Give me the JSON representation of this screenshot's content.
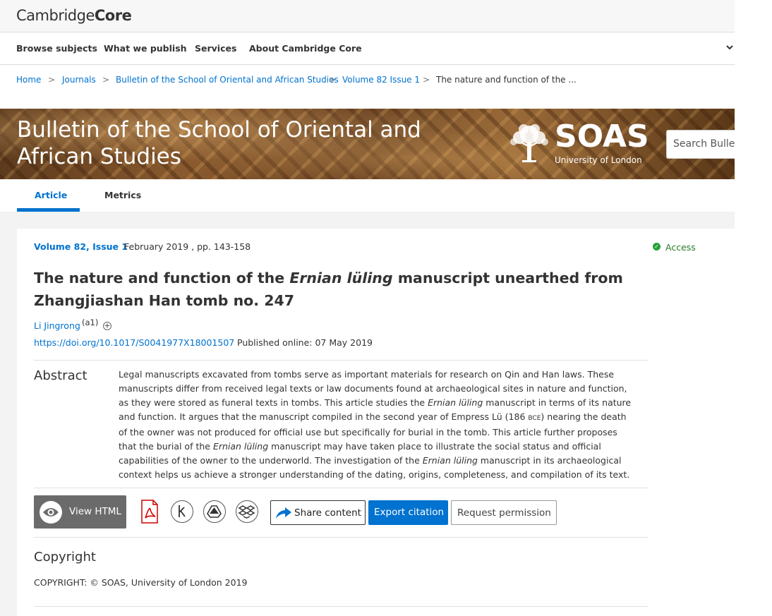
{
  "brand": {
    "logo_part1": "Cambridge",
    "logo_part2": "Core"
  },
  "nav": {
    "items": [
      "Browse subjects",
      "What we publish",
      "Services",
      "About Cambridge Core"
    ],
    "more_icon": "chevron-down-icon"
  },
  "breadcrumb": {
    "items": [
      "Home",
      "Journals",
      "Bulletin of the School of Oriental and African Studies",
      "Volume 82 Issue 1"
    ],
    "current": "The nature and function of the ...",
    "separator": ">"
  },
  "banner": {
    "journal_title": "Bulletin of the School of Oriental and African Studies",
    "partner_name": "SOAS",
    "partner_subtitle": "University of London",
    "search_placeholder": "Search Bulletin"
  },
  "tabs": [
    {
      "label": "Article",
      "active": true
    },
    {
      "label": "Metrics",
      "active": false
    }
  ],
  "article": {
    "volume_issue": "Volume 82, Issue 1",
    "date_pages": "February 2019 , pp. 143-158",
    "access_label": "Access",
    "title_part1": "The nature and function of the ",
    "title_italic": "Ernian lüling",
    "title_part2": " manuscript unearthed from Zhangjiashan Han tomb no. 247",
    "author": "Li Jingrong",
    "affiliation": "(a1)",
    "doi": "https://doi.org/10.1017/S0041977X18001507",
    "published": "Published online: 07 May 2019"
  },
  "abstract": {
    "heading": "Abstract",
    "text_1": "Legal manuscripts excavated from tombs serve as important materials for research on Qin and Han laws. These manuscripts differ from received legal texts or law documents found at archaeological sites in nature and function, as they were stored as funeral texts in tombs. This article studies the ",
    "italic_1": "Ernian lüling",
    "text_2": " manuscript in terms of its nature and function. It argues that the manuscript compiled in the second year of Empress Lü (186 ",
    "era": "BCE",
    "text_3": ") nearing the death of the owner was not produced for official use but specifically for burial in the tomb. This article further proposes that the burial of the ",
    "italic_2": "Ernian lüling",
    "text_4": " manuscript may have taken place to illustrate the social status and official capabilities of the owner to the underworld. The investigation of the ",
    "italic_3": "Ernian lüling",
    "text_5": " manuscript in its archaeological context helps us achieve a stronger understanding of the dating, origins, completeness, and compilation of its text."
  },
  "toolbar": {
    "view_html": "View HTML",
    "share": "Share content",
    "export": "Export citation",
    "permission": "Request permission",
    "icons": [
      "eye-icon",
      "pdf-icon",
      "kindle-icon",
      "google-drive-icon",
      "dropbox-icon",
      "share-arrow-icon"
    ]
  },
  "copyright": {
    "heading": "Copyright",
    "text": "COPYRIGHT: © SOAS, University of London 2019"
  },
  "colors": {
    "link": "#0072cf",
    "access": "#27a137",
    "button_gray": "#6b6b6b"
  }
}
